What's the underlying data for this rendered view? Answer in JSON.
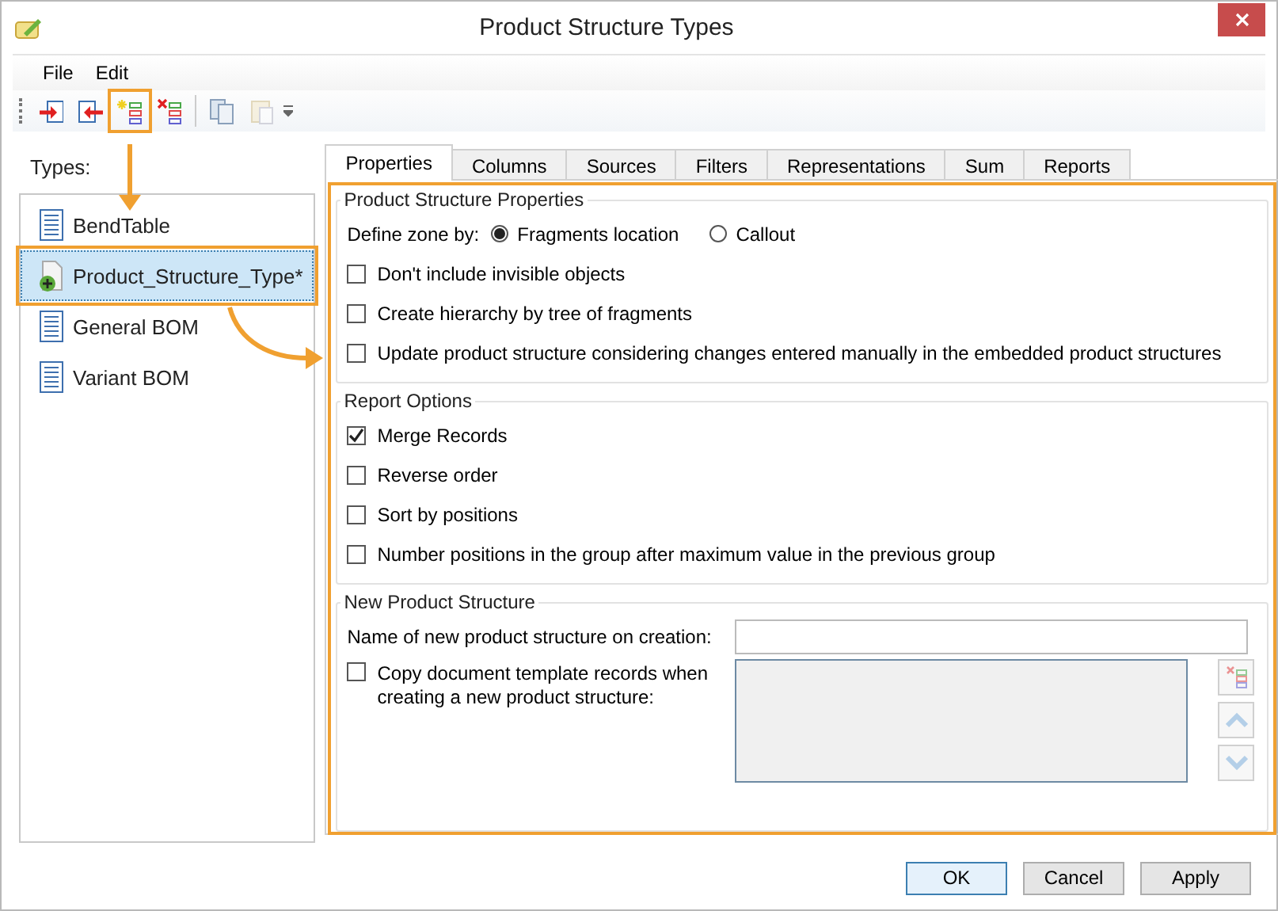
{
  "window": {
    "title": "Product Structure Types"
  },
  "menu": [
    {
      "label": "File"
    },
    {
      "label": "Edit"
    }
  ],
  "toolbar": [
    {
      "kind": "import",
      "disabled": false,
      "highlighted": false
    },
    {
      "kind": "export",
      "disabled": false,
      "highlighted": false
    },
    {
      "kind": "add",
      "disabled": false,
      "highlighted": true
    },
    {
      "kind": "delete",
      "disabled": false,
      "highlighted": false
    },
    {
      "kind": "separator"
    },
    {
      "kind": "copy",
      "disabled": false,
      "highlighted": false
    },
    {
      "kind": "paste",
      "disabled": true,
      "highlighted": false
    }
  ],
  "types": {
    "label": "Types:",
    "items": [
      {
        "label": "BendTable",
        "kind": "document",
        "selected": false,
        "highlighted": false
      },
      {
        "label": "Product_Structure_Type*",
        "kind": "new",
        "selected": true,
        "highlighted": true
      },
      {
        "label": "General BOM",
        "kind": "document",
        "selected": false,
        "highlighted": false
      },
      {
        "label": "Variant BOM",
        "kind": "document",
        "selected": false,
        "highlighted": false
      }
    ]
  },
  "tabs": [
    {
      "label": "Properties",
      "selected": true
    },
    {
      "label": "Columns",
      "selected": false
    },
    {
      "label": "Sources",
      "selected": false
    },
    {
      "label": "Filters",
      "selected": false
    },
    {
      "label": "Representations",
      "selected": false
    },
    {
      "label": "Sum",
      "selected": false
    },
    {
      "label": "Reports",
      "selected": false
    }
  ],
  "properties": {
    "highlighted": true,
    "title": "Product Structure Properties",
    "define_zone": {
      "label": "Define zone by:",
      "options": [
        {
          "label": "Fragments location",
          "selected": true
        },
        {
          "label": "Callout",
          "selected": false
        }
      ]
    },
    "options": [
      {
        "label": "Don't include invisible objects",
        "checked": false
      },
      {
        "label": "Create hierarchy by tree of fragments",
        "checked": false
      },
      {
        "label": "Update product structure considering changes entered manually in the embedded product structures",
        "checked": false
      }
    ]
  },
  "report_options": {
    "title": "Report Options",
    "options": [
      {
        "label": "Merge Records",
        "checked": true
      },
      {
        "label": "Reverse order",
        "checked": false
      },
      {
        "label": "Sort by positions",
        "checked": false
      },
      {
        "label": "Number positions in the group after maximum value in the previous group",
        "checked": false
      }
    ]
  },
  "new_structure": {
    "title": "New Product Structure",
    "name_label": "Name of new product structure on creation:",
    "copy_option": {
      "label": "Copy document template records when creating a new product structure:",
      "checked": false
    },
    "side_buttons": [
      {
        "kind": "delete",
        "disabled": true
      },
      {
        "kind": "up",
        "disabled": true
      },
      {
        "kind": "down",
        "disabled": true
      }
    ]
  },
  "buttons": [
    {
      "label": "OK",
      "default": true
    },
    {
      "label": "Cancel",
      "default": false
    },
    {
      "label": "Apply",
      "default": false
    }
  ]
}
